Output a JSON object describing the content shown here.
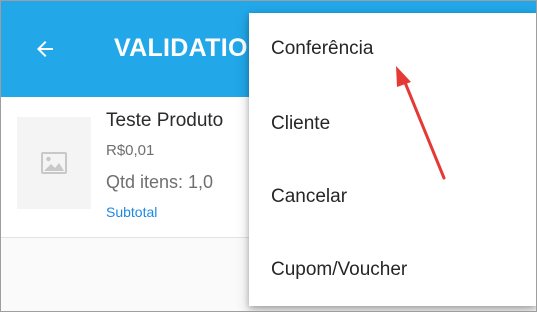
{
  "appbar": {
    "title": "VALIDATIO",
    "back_icon": "arrow-left-icon",
    "color": "#22a7e8"
  },
  "product": {
    "name": "Teste Produto",
    "price": "R$0,01",
    "quantity": "Qtd itens: 1,0",
    "subtotal": "Subtotal",
    "image_icon": "image-placeholder-icon"
  },
  "menu": {
    "items": [
      {
        "label": "Conferência"
      },
      {
        "label": "Cliente"
      },
      {
        "label": "Cancelar"
      },
      {
        "label": "Cupom/Voucher"
      }
    ]
  },
  "annotation": {
    "arrow_color": "#e53935"
  }
}
